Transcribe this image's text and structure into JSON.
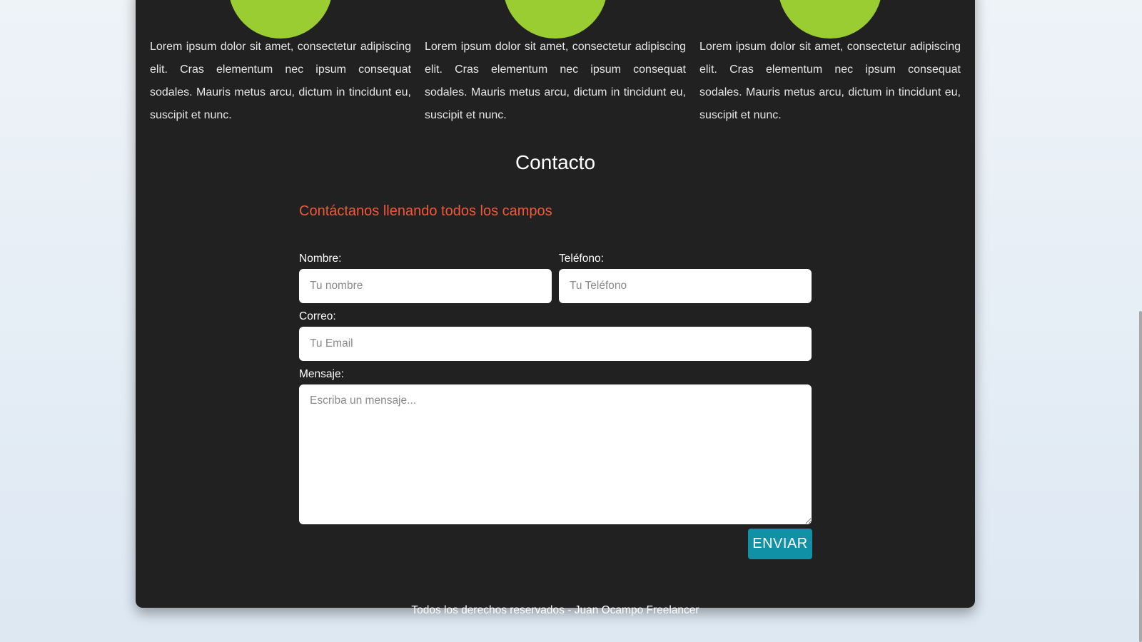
{
  "services": [
    {
      "icon": "service-icon",
      "text": "Lorem ipsum dolor sit amet, consectetur adipiscing elit. Cras elementum nec ipsum consequat sodales. Mauris metus arcu, dictum in tincidunt eu, suscipit et nunc."
    },
    {
      "icon": "service-icon",
      "text": "Lorem ipsum dolor sit amet, consectetur adipiscing elit. Cras elementum nec ipsum consequat sodales. Mauris metus arcu, dictum in tincidunt eu, suscipit et nunc."
    },
    {
      "icon": "service-icon",
      "text": "Lorem ipsum dolor sit amet, consectetur adipiscing elit. Cras elementum nec ipsum consequat sodales. Mauris metus arcu, dictum in tincidunt eu, suscipit et nunc."
    }
  ],
  "contact": {
    "title": "Contacto",
    "subtitle": "Contáctanos llenando todos los campos",
    "fields": {
      "name": {
        "label": "Nombre:",
        "placeholder": "Tu nombre",
        "value": ""
      },
      "phone": {
        "label": "Teléfono:",
        "placeholder": "Tu Teléfono",
        "value": ""
      },
      "email": {
        "label": "Correo:",
        "placeholder": "Tu Email",
        "value": ""
      },
      "message": {
        "label": "Mensaje:",
        "placeholder": "Escriba un mensaje...",
        "value": ""
      }
    },
    "submit_label": "ENVIAR"
  },
  "footer": {
    "text": "Todos los derechos reservados - Juan Ocampo Freelancer"
  },
  "colors": {
    "card_bg": "#212121",
    "accent_green": "#9acd32",
    "subtitle_orange": "#f0583b",
    "button_teal": "#1191a6"
  }
}
